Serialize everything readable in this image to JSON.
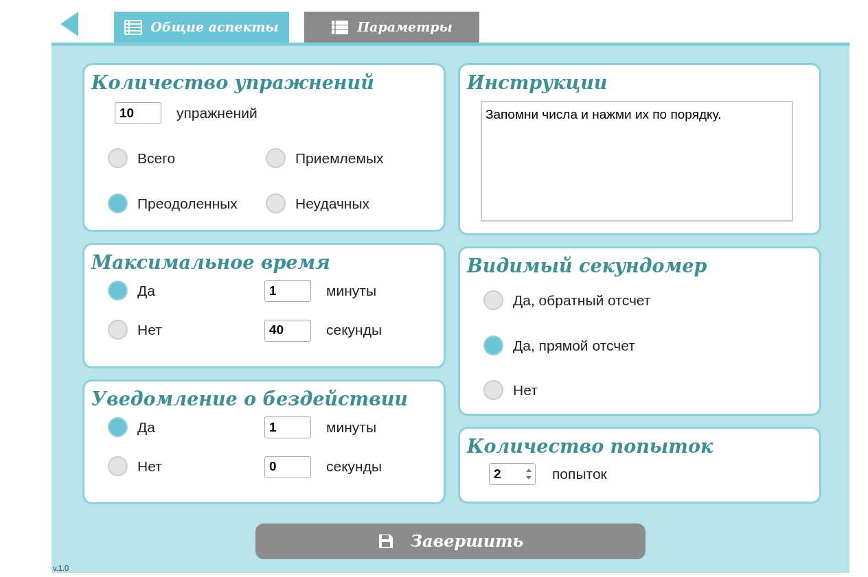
{
  "tabs": [
    {
      "label": "Общие аспекты",
      "selected": true
    },
    {
      "label": "Параметры",
      "selected": false
    }
  ],
  "columns": [
    [
      {
        "kind": "count",
        "title": "Количество упражнений",
        "value": "10",
        "unit": "упражнений",
        "options": [
          {
            "label": "Всего",
            "selected": false
          },
          {
            "label": "Приемлемых",
            "selected": false
          },
          {
            "label": "Преодоленных",
            "selected": true
          },
          {
            "label": "Неудачных",
            "selected": false
          }
        ]
      },
      {
        "kind": "time",
        "title": "Максимальное время",
        "options": [
          {
            "label": "Да",
            "selected": true
          },
          {
            "label": "Нет",
            "selected": false
          }
        ],
        "fields": [
          {
            "value": "1",
            "unit": "минуты"
          },
          {
            "value": "40",
            "unit": "секунды"
          }
        ]
      },
      {
        "kind": "time",
        "title": "Уведомление о бездействии",
        "options": [
          {
            "label": "Да",
            "selected": true
          },
          {
            "label": "Нет",
            "selected": false
          }
        ],
        "fields": [
          {
            "value": "1",
            "unit": "минуты"
          },
          {
            "value": "0",
            "unit": "секунды"
          }
        ]
      }
    ],
    [
      {
        "kind": "text",
        "title": "Инструкции",
        "value": "Запомни числа и нажми их по порядку."
      },
      {
        "kind": "radios",
        "title": "Видимый секундомер",
        "options": [
          {
            "label": "Да, обратный отсчет",
            "selected": false
          },
          {
            "label": "Да, прямой отсчет",
            "selected": true
          },
          {
            "label": "Нет",
            "selected": false
          }
        ]
      },
      {
        "kind": "spinner",
        "title": "Количество попыток",
        "value": "2",
        "unit": "попыток"
      }
    ]
  ],
  "finish_button": "Завершить",
  "version": "v.1.0"
}
